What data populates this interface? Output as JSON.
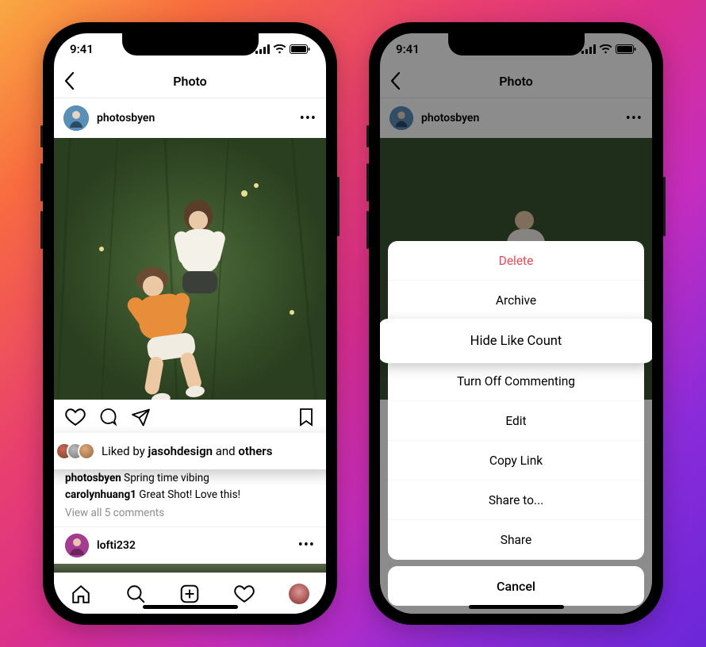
{
  "statusbar": {
    "time": "9:41"
  },
  "header": {
    "title": "Photo"
  },
  "post": {
    "author": "photosbyen",
    "caption_author": "photosbyen",
    "caption_text": "Spring time vibing",
    "comment_author": "carolynhuang1",
    "comment_text": "Great Shot! Love this!",
    "view_all": "View all 5 comments",
    "liked_by_prefix": "Liked by ",
    "liked_by_user": "jasohdesign",
    "liked_by_middle": " and ",
    "liked_by_suffix": "others"
  },
  "suggestion": {
    "username": "lofti232"
  },
  "action_sheet": {
    "items": [
      {
        "label": "Delete",
        "destructive": true
      },
      {
        "label": "Archive"
      },
      {
        "label": "Hide Like Count",
        "highlight": true
      },
      {
        "label": "Turn Off Commenting"
      },
      {
        "label": "Edit"
      },
      {
        "label": "Copy Link"
      },
      {
        "label": "Share to..."
      },
      {
        "label": "Share"
      }
    ],
    "cancel": "Cancel"
  }
}
